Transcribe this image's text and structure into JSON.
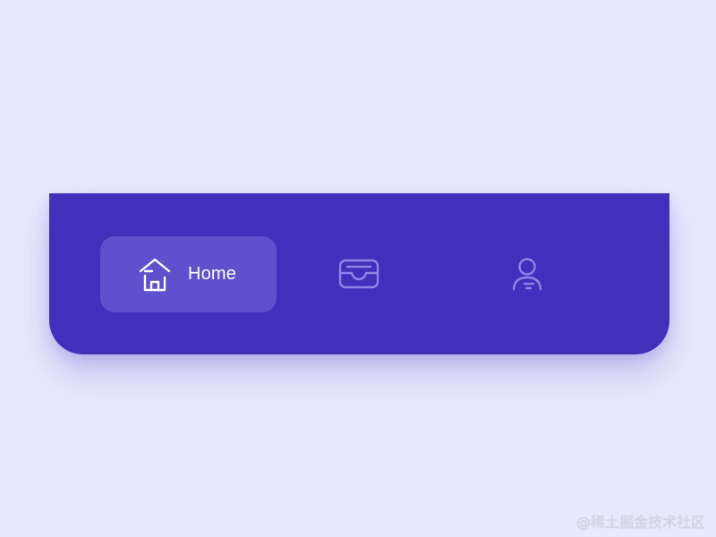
{
  "tabbar": {
    "items": [
      {
        "label": "Home",
        "icon": "home-icon",
        "active": true
      },
      {
        "label": "",
        "icon": "inbox-icon",
        "active": false
      },
      {
        "label": "",
        "icon": "user-icon",
        "active": false
      }
    ]
  },
  "watermark": "@稀土掘金技术社区",
  "colors": {
    "background": "#E9E9FD",
    "tabbar": "#3F31BC",
    "active_pill": "#5E51CD",
    "inactive_icon": "#8D85E6",
    "active_text": "#FFFFFF"
  }
}
